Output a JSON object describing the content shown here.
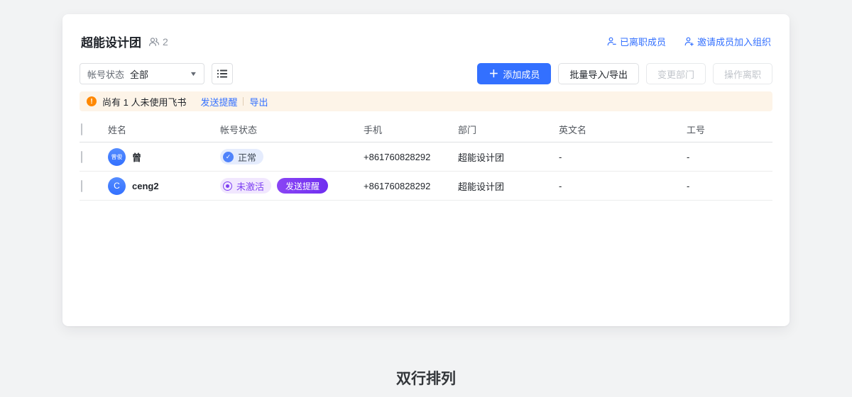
{
  "header": {
    "title": "超能设计团",
    "member_count": "2",
    "links": {
      "resigned": "已离职成员",
      "invite": "邀请成员加入组织"
    }
  },
  "toolbar": {
    "filter_label": "帐号状态",
    "filter_value": "全部",
    "add_button": "添加成员",
    "batch_button": "批量导入/导出",
    "change_dept_button": "变更部门",
    "resign_button": "操作离职"
  },
  "banner": {
    "text": "尚有 1 人未使用飞书",
    "link_remind": "发送提醒",
    "link_export": "导出"
  },
  "table": {
    "headers": [
      "姓名",
      "帐号状态",
      "手机",
      "部门",
      "英文名",
      "工号"
    ],
    "rows": [
      {
        "avatar_text": "曾俊",
        "name": "曾",
        "status": "正常",
        "phone": "+861760828292",
        "department": "超能设计团",
        "english_name": "-",
        "employee_id": "-"
      },
      {
        "avatar_text": "C",
        "name": "ceng2",
        "status": "未激活",
        "action": "发送提醒",
        "phone": "+861760828292",
        "department": "超能设计团",
        "english_name": "-",
        "employee_id": "-"
      }
    ]
  },
  "icons": {
    "plus": "＋",
    "caret_down": "▼",
    "check": "✓",
    "warning": "!"
  },
  "colors": {
    "accent_blue": "#3370ff",
    "warning_orange": "#ff8800",
    "purple": "#7d3ff2",
    "banner_bg": "#fdf4e8",
    "badge_blue_bg": "#e5ecfd",
    "badge_purple_bg": "#f1e7fe"
  },
  "caption": "双行排列"
}
